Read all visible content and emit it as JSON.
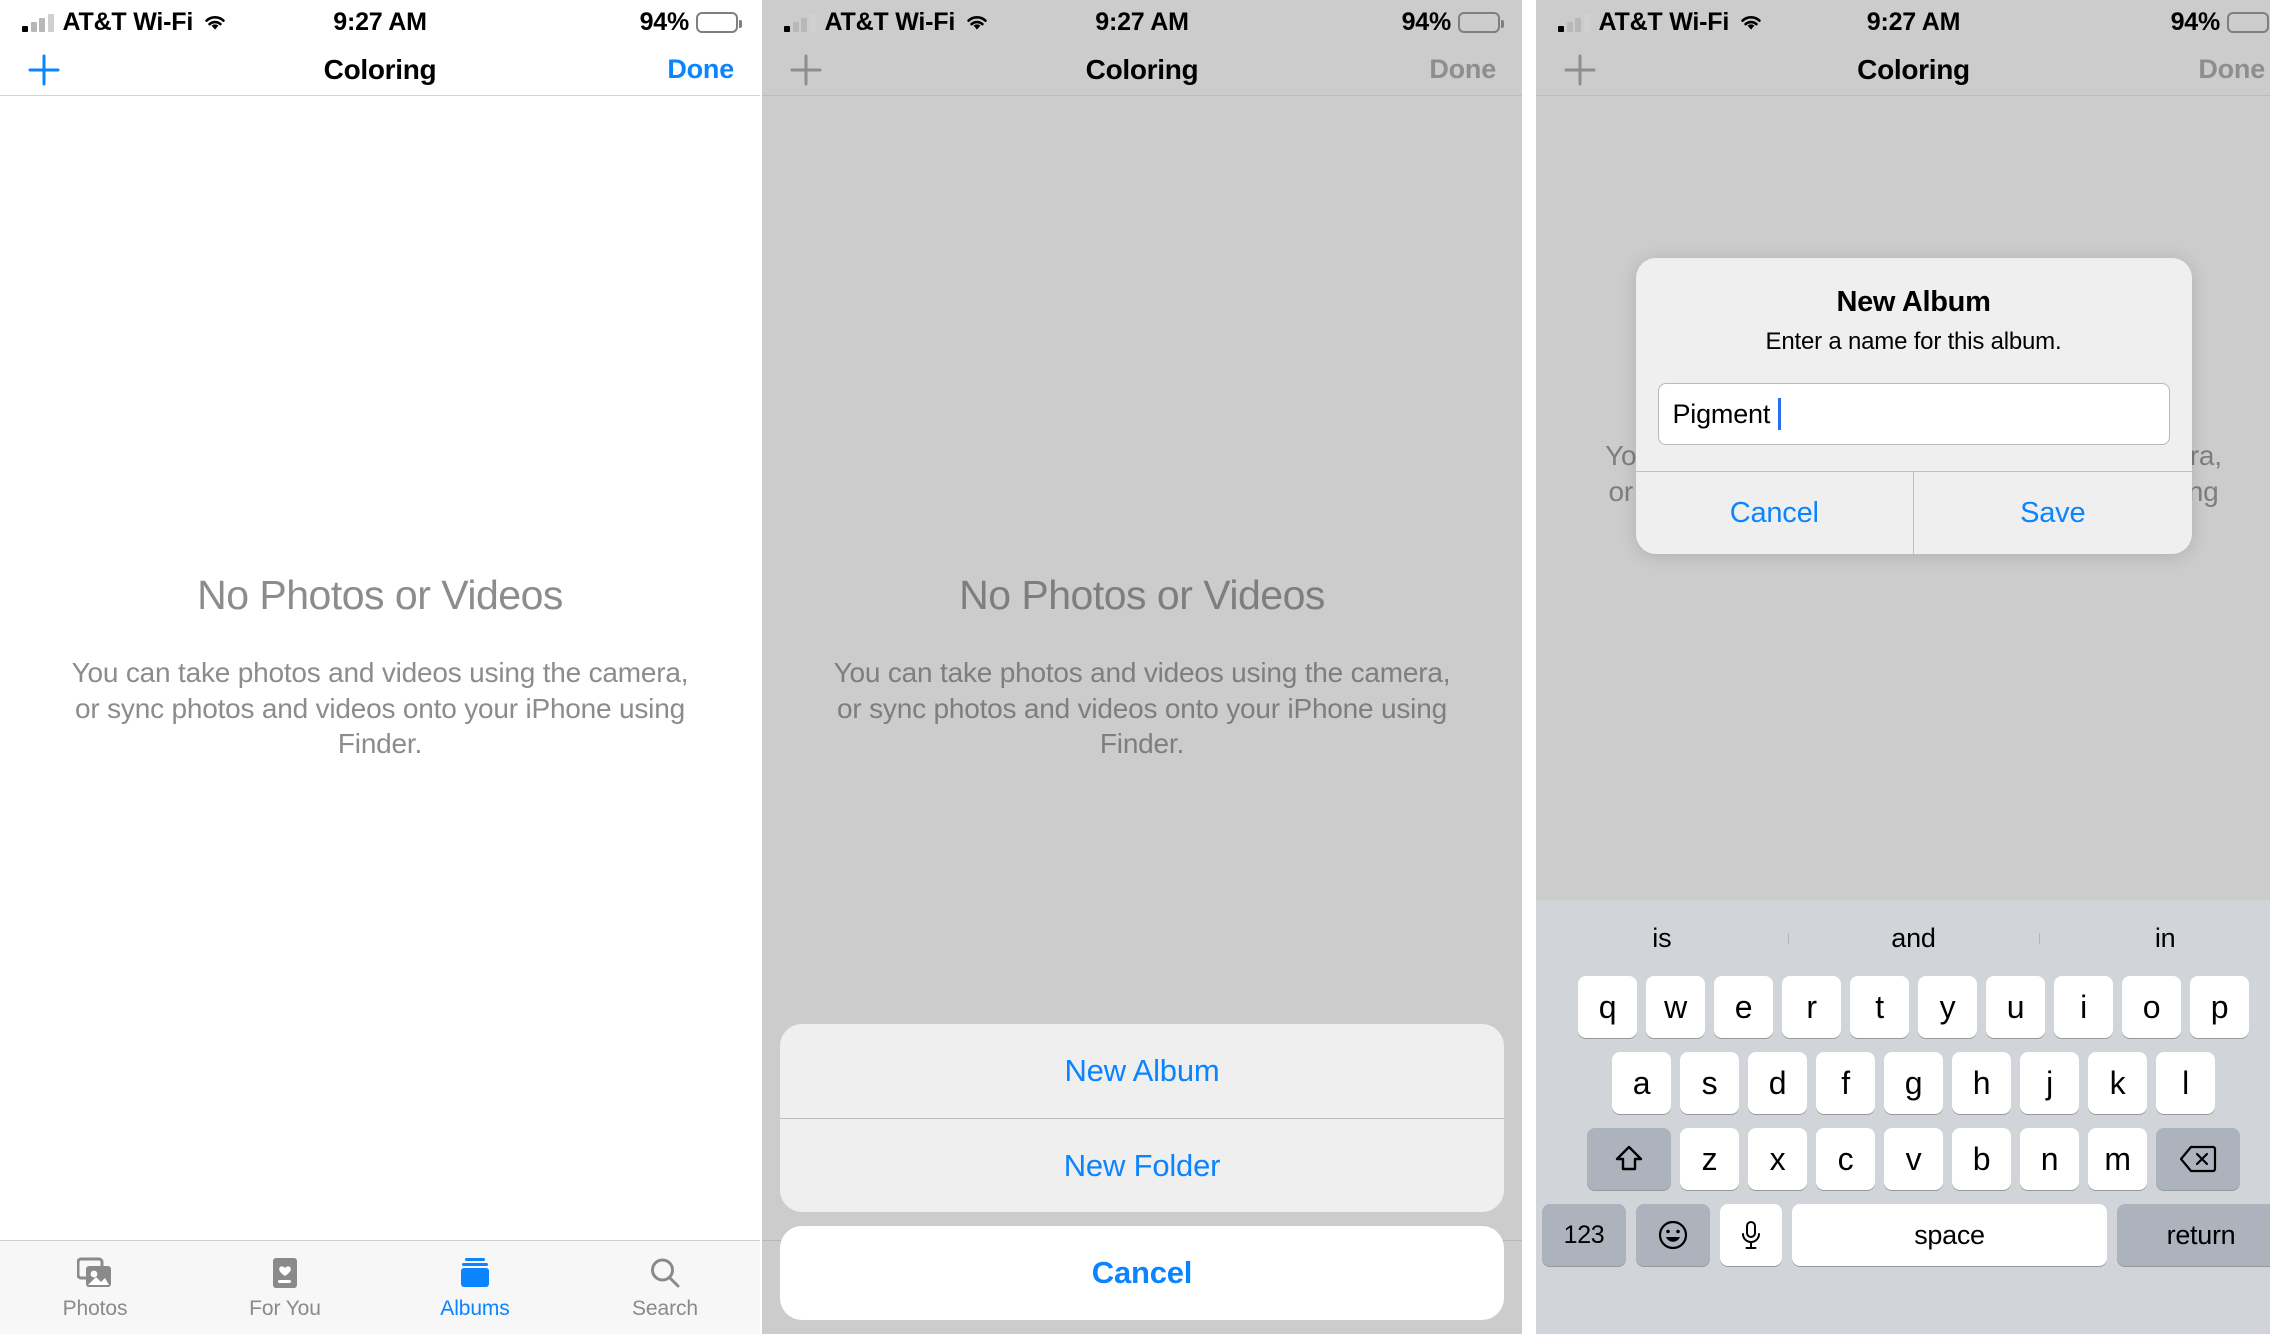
{
  "status_bar": {
    "carrier": "AT&T Wi-Fi",
    "time": "9:27 AM",
    "battery_percent": "94%",
    "signal_icon": "cellular-signal-icon",
    "wifi_icon": "wifi-icon",
    "battery_icon": "battery-icon"
  },
  "nav": {
    "add_icon": "plus-icon",
    "title": "Coloring",
    "done_label": "Done"
  },
  "empty_state": {
    "title": "No Photos or Videos",
    "subtitle": "You can take photos and videos using the camera, or sync photos and videos onto your iPhone using Finder."
  },
  "tab_bar": {
    "tabs": [
      {
        "label": "Photos",
        "icon": "photos-icon",
        "active": false
      },
      {
        "label": "For You",
        "icon": "for-you-icon",
        "active": false
      },
      {
        "label": "Albums",
        "icon": "albums-icon",
        "active": true
      },
      {
        "label": "Search",
        "icon": "search-icon",
        "active": false
      }
    ]
  },
  "action_sheet": {
    "items": [
      {
        "label": "New Album"
      },
      {
        "label": "New Folder"
      }
    ],
    "cancel_label": "Cancel"
  },
  "alert": {
    "title": "New Album",
    "message": "Enter a name for this album.",
    "input_value": "Pigment",
    "input_placeholder": "",
    "cancel_label": "Cancel",
    "save_label": "Save"
  },
  "keyboard": {
    "predictions": [
      "is",
      "and",
      "in"
    ],
    "row1": [
      "q",
      "w",
      "e",
      "r",
      "t",
      "y",
      "u",
      "i",
      "o",
      "p"
    ],
    "row2": [
      "a",
      "s",
      "d",
      "f",
      "g",
      "h",
      "j",
      "k",
      "l"
    ],
    "row3": [
      "z",
      "x",
      "c",
      "v",
      "b",
      "n",
      "m"
    ],
    "shift_icon": "shift-icon",
    "backspace_icon": "backspace-icon",
    "numbers_label": "123",
    "emoji_icon": "emoji-icon",
    "mic_icon": "microphone-icon",
    "space_label": "space",
    "return_label": "return"
  },
  "colors": {
    "accent": "#0a84ff",
    "dim_background": "#cccccc",
    "keyboard_background": "#d1d4d9",
    "caret": "#2b6cf6"
  }
}
